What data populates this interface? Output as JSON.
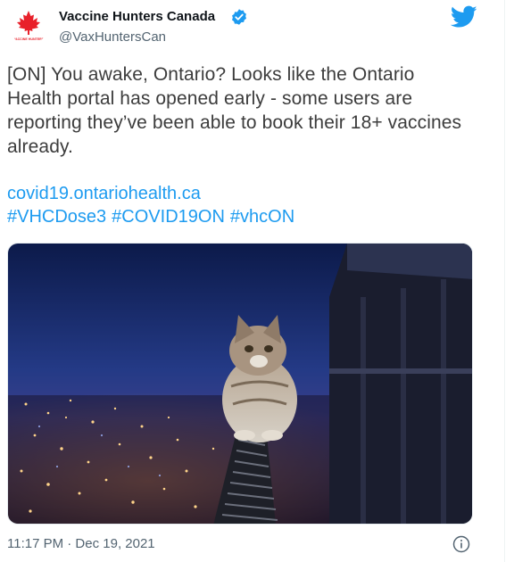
{
  "author": {
    "display_name": "Vaccine Hunters Canada",
    "handle": "@VaxHuntersCan",
    "logo_text": "VACCINE HUNTERS",
    "verified": true,
    "avatar_icon": "maple-leaf-icon"
  },
  "platform_icon": "twitter-bird-icon",
  "tweet": {
    "text": "[ON] You awake, Ontario? Looks like the Ontario Health portal has opened early - some users are reporting they’ve been able to book their 18+ vaccines already.",
    "link": "covid19.ontariohealth.ca",
    "hashtags": [
      "#VHCDose3",
      "#COVID19ON",
      "#vhcON"
    ]
  },
  "media": {
    "description_icon": "cat-on-balcony-railing-photo"
  },
  "meta": {
    "timestamp": "11:17 PM · Dec 19, 2021"
  },
  "colors": {
    "link": "#1d9bf0",
    "text": "#3c3c3c",
    "secondary": "#536471",
    "brand_red": "#e8202a"
  }
}
